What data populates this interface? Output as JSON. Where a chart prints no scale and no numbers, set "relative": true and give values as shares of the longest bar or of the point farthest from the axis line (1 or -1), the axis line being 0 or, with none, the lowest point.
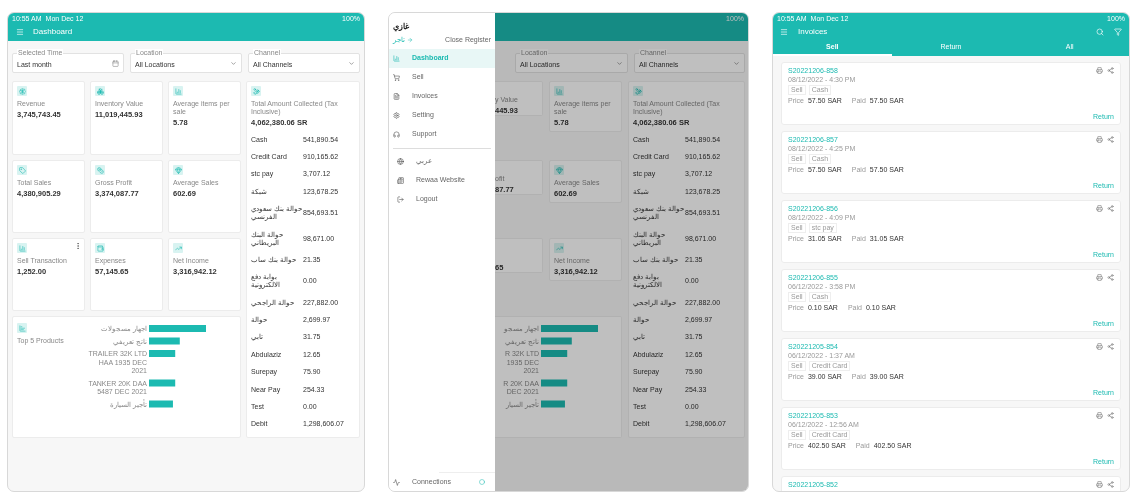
{
  "dashboard_screen": {
    "status_bar": {
      "time": "10:55 AM",
      "date": "Mon Dec 12",
      "battery": "100%"
    },
    "title": "Dashboard",
    "filters": [
      {
        "kind": "date",
        "label": "Selected Time",
        "value": "Last month"
      },
      {
        "kind": "select",
        "label": "Location",
        "value": "All Locations"
      },
      {
        "kind": "select",
        "label": "Channel",
        "value": "All Channels"
      }
    ],
    "cards": [
      {
        "title": "Revenue",
        "value": "3,745,743.45"
      },
      {
        "title": "Inventory Value",
        "value": "11,019,445.93"
      },
      {
        "title": "Average items per sale",
        "value": "5.78"
      },
      {
        "title": "Total Sales",
        "value": "4,380,905.29"
      },
      {
        "title": "Gross Profit",
        "value": "3,374,087.77"
      },
      {
        "title": "Average Sales",
        "value": "602.69"
      },
      {
        "title": "Sell Transaction",
        "value": "1,252.00",
        "menu": true
      },
      {
        "title": "Expenses",
        "value": "57,145.65"
      },
      {
        "title": "Net Income",
        "value": "3,316,942.12"
      }
    ],
    "chart": {
      "title": "Top 5 Products",
      "chart_data": {
        "type": "bar",
        "orientation": "horizontal",
        "relative": true,
        "categories": [
          "اجهار مسجولات",
          "ناتج تعريفي",
          "TRAILER 32K LTD\nHAA 1935 DEC\n2021",
          "TANKER 20K DAA\n5487 DEC 2021",
          "تأجير السيارة"
        ],
        "values": [
          1,
          0.54,
          0.46,
          0.46,
          0.42
        ]
      }
    },
    "totals": {
      "title": "Total Amount Collected (Tax Inclusive)",
      "amount": "4,062,380.06 SR",
      "rows": [
        {
          "name": "Cash",
          "value": "541,890.54"
        },
        {
          "name": "Credit Card",
          "value": "910,165.62"
        },
        {
          "name": "stc pay",
          "value": "3,707.12"
        },
        {
          "name": "شبكة",
          "value": "123,678.25"
        },
        {
          "name": "حوالة بنك سعودي الفرنسي",
          "value": "854,693.51"
        },
        {
          "name": "حوالة البنك البريطاني",
          "value": "98,671.00"
        },
        {
          "name": "حوالة بنك ساب",
          "value": "21.35"
        },
        {
          "name": "بوابة دفع الالكترونية",
          "value": "0.00"
        },
        {
          "name": "حوالة الراجحي",
          "value": "227,882.00"
        },
        {
          "name": "حوالة",
          "value": "2,699.97"
        },
        {
          "name": "تابي",
          "value": "31.75"
        },
        {
          "name": "Abdulaziz",
          "value": "12.65"
        },
        {
          "name": "Surepay",
          "value": "75.90"
        },
        {
          "name": "Near Pay",
          "value": "254.33"
        },
        {
          "name": "Test",
          "value": "0.00"
        },
        {
          "name": "Debit",
          "value": "1,298,606.07"
        }
      ]
    }
  },
  "menu_screen": {
    "status_bar": {
      "battery": "100%"
    },
    "drawer": {
      "user": "غازي",
      "role": "تاجر",
      "close_register": "Close Register",
      "groups": [
        [
          {
            "label": "Dashboard",
            "selected": true
          },
          {
            "label": "Sell",
            "selected": false
          },
          {
            "label": "Invoices",
            "selected": false
          },
          {
            "label": "Setting",
            "selected": false
          },
          {
            "label": "Support",
            "selected": false
          }
        ],
        [
          {
            "label": "عربي",
            "selected": false
          },
          {
            "label": "Rewaa Website",
            "selected": false
          },
          {
            "label": "Logout",
            "selected": false
          }
        ]
      ],
      "footer": "Connections"
    },
    "filters": [
      {
        "kind": "select",
        "label": "Location",
        "value": "All Locations"
      },
      {
        "kind": "select",
        "label": "Channel",
        "value": "All Channels"
      }
    ],
    "cut_cards": [
      {
        "title": "y Value",
        "value": "445.93"
      },
      {
        "title": "ofit",
        "value": "87.77"
      },
      {
        "value": "65"
      }
    ],
    "cards": [
      {
        "title": "Average items per sale",
        "value": "5.78"
      },
      {
        "title": "Average Sales",
        "value": "602.69"
      },
      {
        "title": "Net Income",
        "value": "3,316,942.12"
      }
    ],
    "chart": {
      "chart_data": {
        "type": "bar",
        "orientation": "horizontal",
        "relative": true,
        "categories": [
          "اجهار مسجو",
          "ناتج تعريفي",
          "R 32K LTD\n1935 DEC\n2021",
          "R 20K DAA\nDEC 2021",
          "تأجير السيار"
        ],
        "values": [
          1,
          0.54,
          0.46,
          0.46,
          0.42
        ]
      }
    },
    "totals": {
      "title": "Total Amount Collected (Tax Inclusive)",
      "amount": "4,062,380.06 SR",
      "rows": [
        {
          "name": "Cash",
          "value": "541,890.54"
        },
        {
          "name": "Credit Card",
          "value": "910,165.62"
        },
        {
          "name": "stc pay",
          "value": "3,707.12"
        },
        {
          "name": "شبكة",
          "value": "123,678.25"
        },
        {
          "name": "حوالة بنك سعودي الفرنسي",
          "value": "854,693.51"
        },
        {
          "name": "حوالة البنك البريطاني",
          "value": "98,671.00"
        },
        {
          "name": "حوالة بنك ساب",
          "value": "21.35"
        },
        {
          "name": "بوابة دفع الالكترونية",
          "value": "0.00"
        },
        {
          "name": "حوالة الراجحي",
          "value": "227,882.00"
        },
        {
          "name": "حوالة",
          "value": "2,699.97"
        },
        {
          "name": "تابي",
          "value": "31.75"
        },
        {
          "name": "Abdulaziz",
          "value": "12.65"
        },
        {
          "name": "Surepay",
          "value": "75.90"
        },
        {
          "name": "Near Pay",
          "value": "254.33"
        },
        {
          "name": "Test",
          "value": "0.00"
        },
        {
          "name": "Debit",
          "value": "1,298,606.07"
        }
      ]
    }
  },
  "invoices_screen": {
    "status_bar": {
      "time": "10:55 AM",
      "date": "Mon Dec 12",
      "battery": "100%"
    },
    "title": "Invoices",
    "tabs": [
      {
        "label": "Sell",
        "selected": true
      },
      {
        "label": "Return",
        "selected": false
      },
      {
        "label": "All",
        "selected": false
      }
    ],
    "invoices": [
      {
        "number": "S20221206-858",
        "date": "08/12/2022 - 4:30 PM",
        "tags": [
          "Sell",
          "Cash"
        ],
        "price_label": "Price",
        "price": "57.50 SAR",
        "paid_label": "Paid",
        "paid": "57.50 SAR",
        "action": "Return"
      },
      {
        "number": "S20221206-857",
        "date": "08/12/2022 - 4:25 PM",
        "tags": [
          "Sell",
          "Cash"
        ],
        "price_label": "Price",
        "price": "57.50 SAR",
        "paid_label": "Paid",
        "paid": "57.50 SAR",
        "action": "Return"
      },
      {
        "number": "S20221206-856",
        "date": "08/12/2022 - 4:09 PM",
        "tags": [
          "Sell",
          "stc pay"
        ],
        "price_label": "Price",
        "price": "31.05 SAR",
        "paid_label": "Paid",
        "paid": "31.05 SAR",
        "action": "Return"
      },
      {
        "number": "S20221206-855",
        "date": "06/12/2022 - 3:58 PM",
        "tags": [
          "Sell",
          "Cash"
        ],
        "price_label": "Price",
        "price": "0.10 SAR",
        "paid_label": "Paid",
        "paid": "0.10 SAR",
        "action": "Return"
      },
      {
        "number": "S20221205-854",
        "date": "06/12/2022 - 1:37 AM",
        "tags": [
          "Sell",
          "Credit Card"
        ],
        "price_label": "Price",
        "price": "39.00 SAR",
        "paid_label": "Paid",
        "paid": "39.00 SAR",
        "action": "Return"
      },
      {
        "number": "S20221205-853",
        "date": "06/12/2022 - 12:56 AM",
        "tags": [
          "Sell",
          "Credit Card"
        ],
        "price_label": "Price",
        "price": "402.50 SAR",
        "paid_label": "Paid",
        "paid": "402.50 SAR",
        "action": "Return"
      },
      {
        "number": "S20221205-852"
      }
    ]
  }
}
